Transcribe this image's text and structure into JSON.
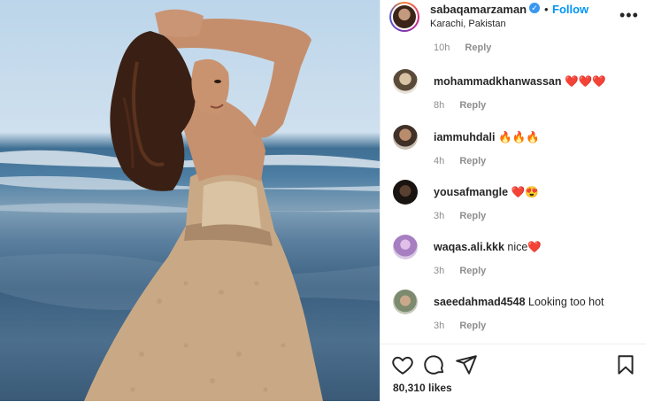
{
  "post": {
    "username": "sabaqamarzaman",
    "verified_icon": "verified-badge-icon",
    "follow_label": "Follow",
    "separator": "•",
    "location": "Karachi, Pakistan",
    "more_label": "•••",
    "likes": "80,310 likes"
  },
  "top_comment_meta": {
    "time": "10h",
    "reply": "Reply"
  },
  "comments": [
    {
      "user": "mohammadkhanwassan",
      "text": "",
      "emoji": "❤️❤️❤️",
      "time": "8h",
      "reply": "Reply",
      "avatar_color": "#7a6a55"
    },
    {
      "user": "iammuhdali",
      "text": "",
      "emoji": "🔥🔥🔥",
      "time": "4h",
      "reply": "Reply",
      "avatar_color": "#6e5a4a"
    },
    {
      "user": "yousafmangle",
      "text": "",
      "emoji": "❤️😍",
      "time": "3h",
      "reply": "Reply",
      "avatar_color": "#2a2018"
    },
    {
      "user": "waqas.ali.kkk",
      "text": "nice",
      "emoji": "❤️",
      "time": "3h",
      "reply": "Reply",
      "avatar_color": "#b79bc9"
    },
    {
      "user": "saeedahmad4548",
      "text": "Looking too hot",
      "emoji": "",
      "time": "3h",
      "reply": "Reply",
      "avatar_color": "#9aa08e"
    }
  ],
  "icons": {
    "like": "heart-icon",
    "comment": "comment-icon",
    "share": "share-icon",
    "save": "bookmark-icon"
  }
}
